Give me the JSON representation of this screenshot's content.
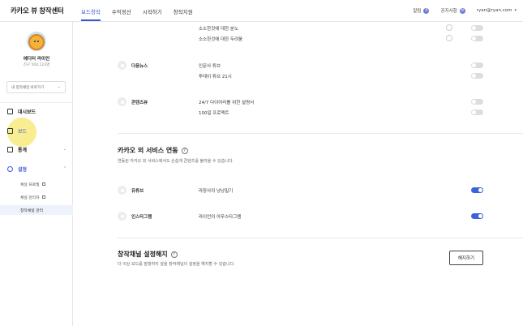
{
  "header": {
    "logo": "카카오 뷰 창작센터",
    "nav": [
      "보드창작",
      "수익정산",
      "시작하기",
      "창작지원"
    ],
    "alert_label": "알림",
    "alert_count": "0",
    "notice_label": "공지사항",
    "notice_count": "N",
    "account": "ryan@ryan.com"
  },
  "sidebar": {
    "profile_name": "에디터 라이언",
    "profile_sub": "친구 504,123명",
    "channel_select_placeholder": "내 창작채널 바로가기",
    "menu": {
      "dashboard": "대시보드",
      "board": "보드",
      "stats": "통계",
      "settings": "설정"
    },
    "sub": [
      "채널 프로필",
      "채널 관리자",
      "창작채널 관리"
    ]
  },
  "top_boards": [
    "소소한것에 대한 분노",
    "소소한것에 대한 두려움"
  ],
  "services": [
    {
      "name": "다음뉴스",
      "boards": [
        "인문사 튜브",
        "투데이 튜브 21시"
      ]
    },
    {
      "name": "콘텐츠뷰",
      "boards": [
        "24/7 다이어리를 위한 설명서",
        "100일 프로젝트"
      ]
    }
  ],
  "external_section": {
    "title": "카카오 외 서비스 연동",
    "help": "?",
    "desc": "연동된 카카오 외 서비스에서도 손쉽게 콘텐츠를 불러올 수 있습니다.",
    "items": [
      {
        "name": "유튜브",
        "account": "라장사의 냥냥밀기",
        "enabled": true
      },
      {
        "name": "인스타그램",
        "account": "라이언의 아무스타그램",
        "enabled": true
      }
    ]
  },
  "cancel_section": {
    "title": "창작채널 설정해지",
    "help": "?",
    "desc": "더 이상 보드를 발행하지 않을 창작채널의 설정을 해지할 수 있습니다.",
    "button": "해지하기"
  },
  "colors": {
    "accent": "#3a57d8",
    "toggle_on": "#3e63d8",
    "highlight": "#f7ea7d"
  }
}
